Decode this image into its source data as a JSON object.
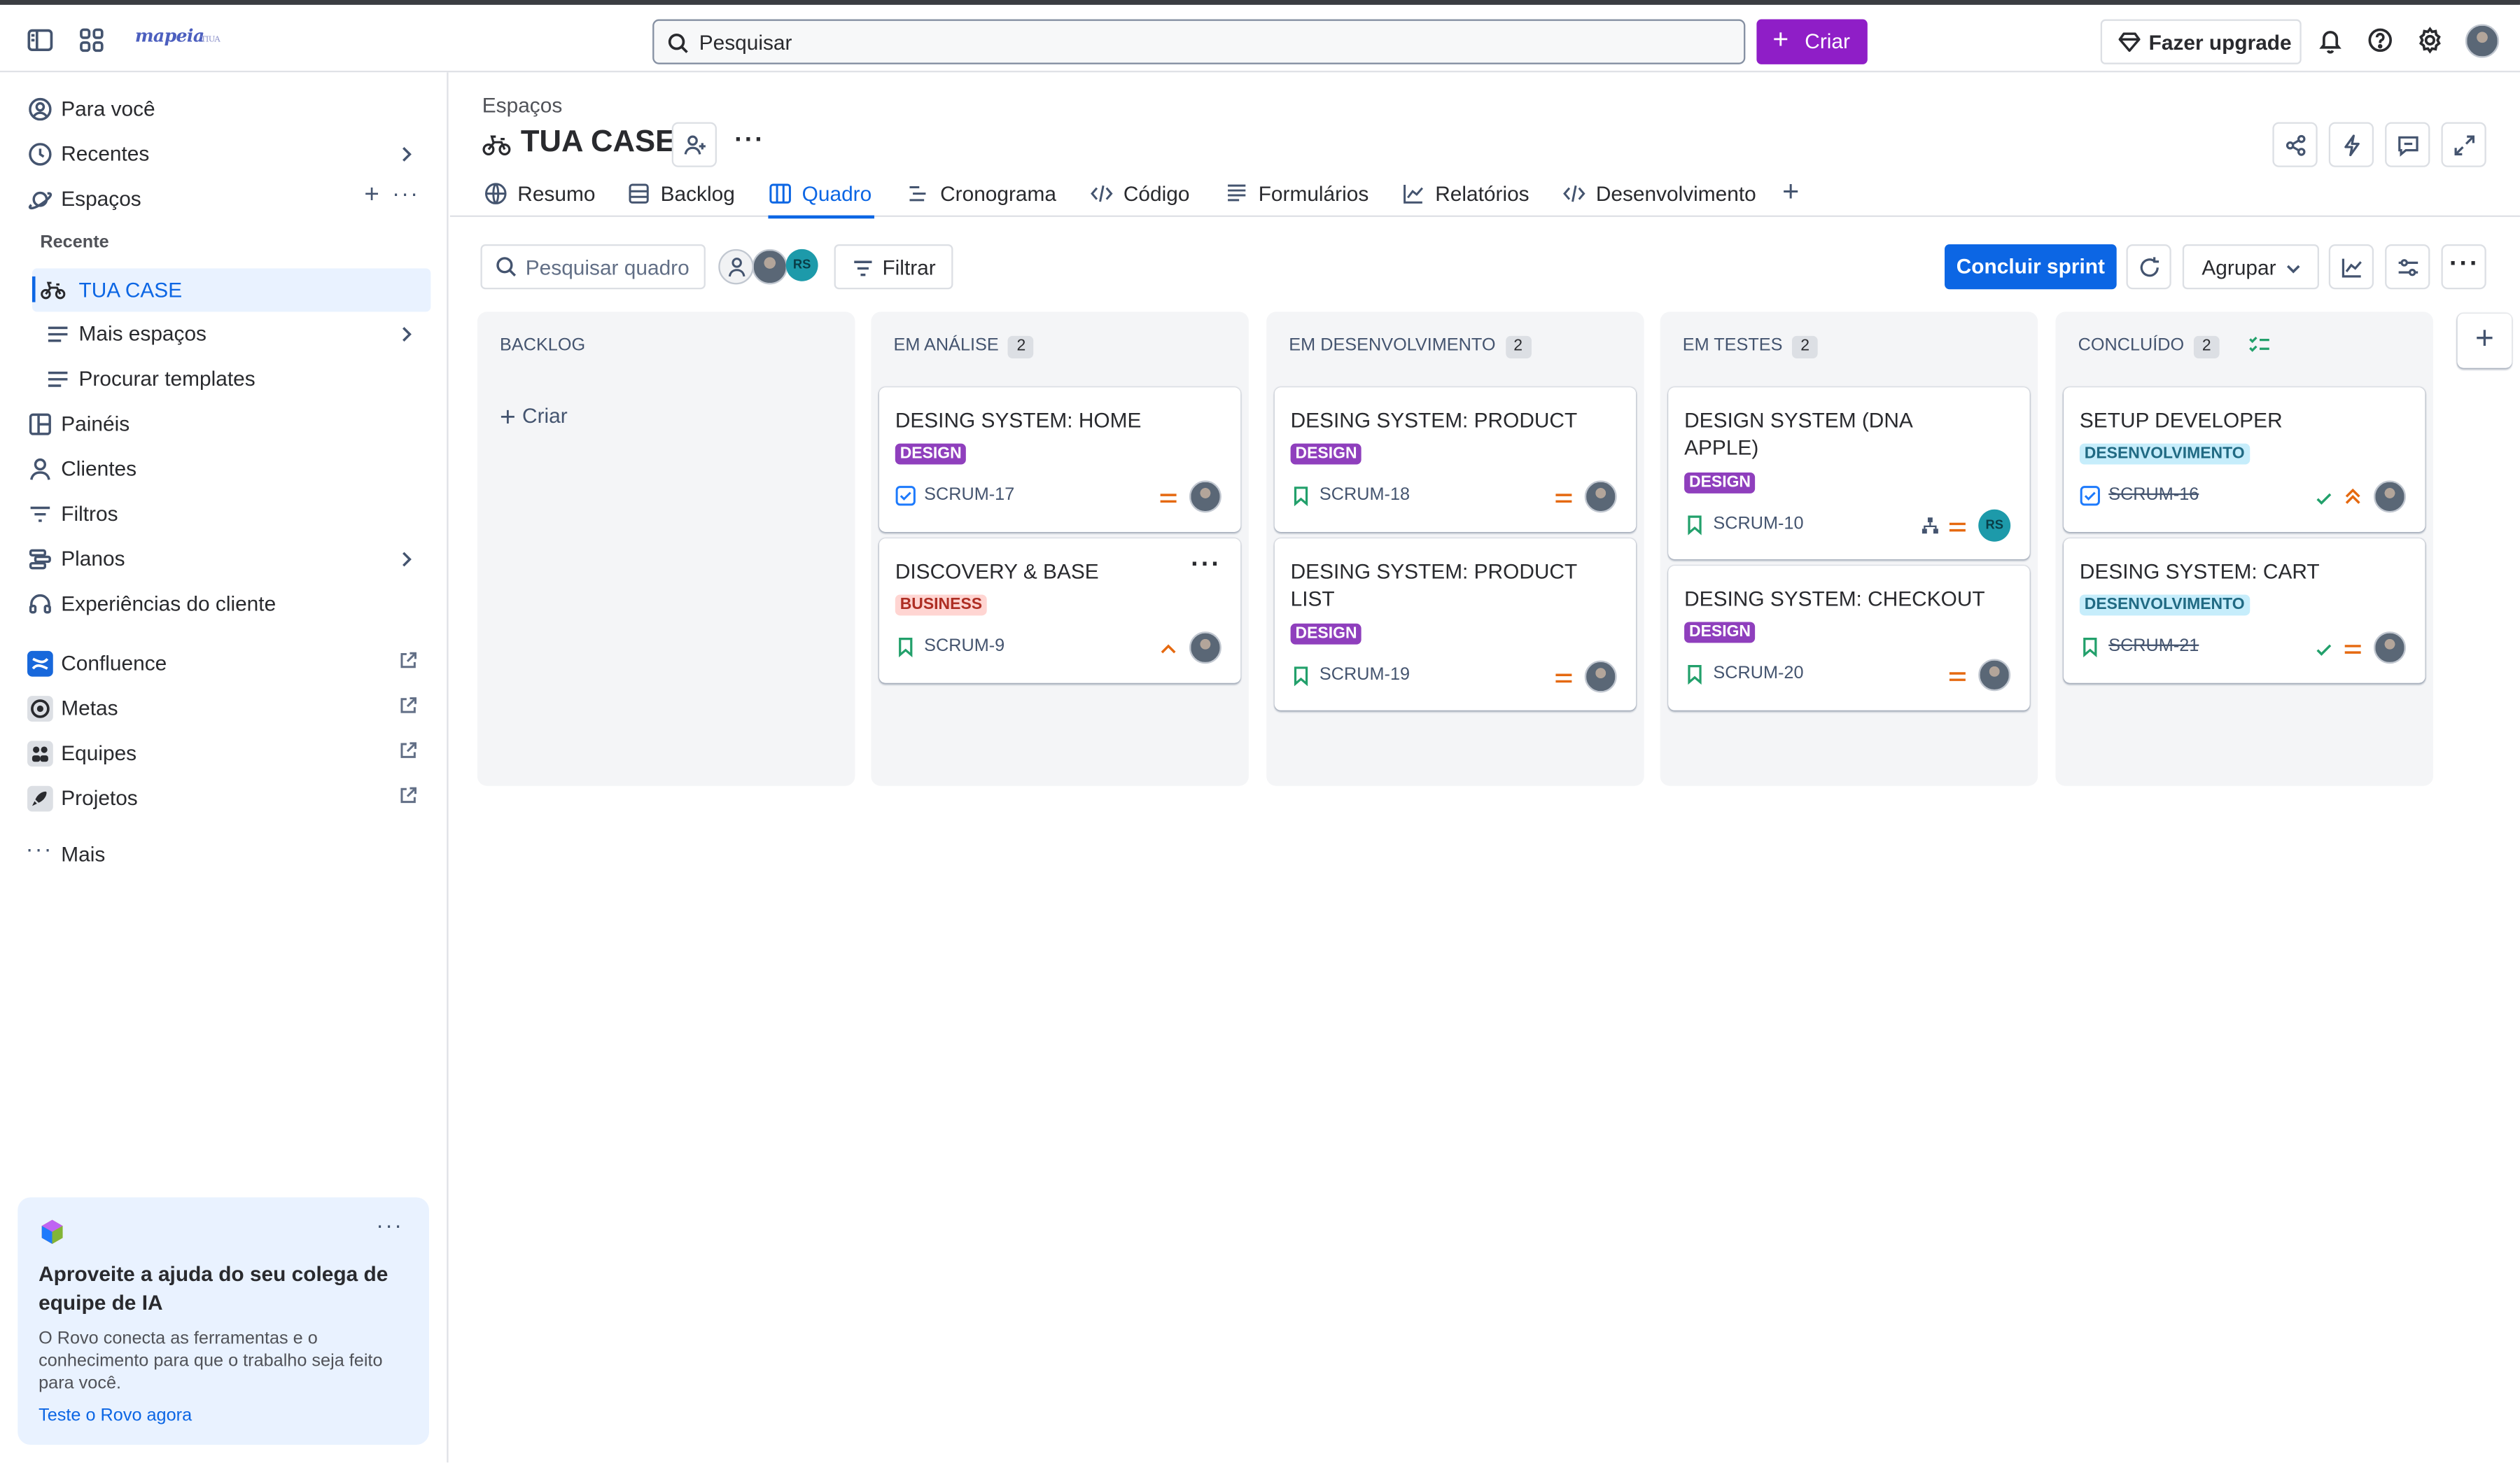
{
  "topbar": {
    "logo_text": "mapeia",
    "logo_sub": "TIUA",
    "search_placeholder": "Pesquisar",
    "create_label": "Criar",
    "upgrade_label": "Fazer upgrade",
    "create_color": "#8f1ec7"
  },
  "sidebar": {
    "items": [
      {
        "label": "Para você",
        "icon": "user-circle-icon"
      },
      {
        "label": "Recentes",
        "icon": "clock-icon"
      },
      {
        "label": "Espaços",
        "icon": "planet-icon"
      }
    ],
    "recent_heading": "Recente",
    "selected_space": "TUA CASE",
    "sub_items": [
      {
        "label": "Mais espaços",
        "icon": "lines-icon"
      },
      {
        "label": "Procurar templates",
        "icon": "lines-icon"
      }
    ],
    "items2": [
      {
        "label": "Painéis",
        "icon": "dashboard-icon"
      },
      {
        "label": "Clientes",
        "icon": "person-icon"
      },
      {
        "label": "Filtros",
        "icon": "filter-icon"
      },
      {
        "label": "Planos",
        "icon": "plans-icon"
      },
      {
        "label": "Experiências do cliente",
        "icon": "headset-icon"
      }
    ],
    "apps": [
      {
        "label": "Confluence",
        "icon": "confluence-icon"
      },
      {
        "label": "Metas",
        "icon": "goals-icon"
      },
      {
        "label": "Equipes",
        "icon": "teams-icon"
      },
      {
        "label": "Projetos",
        "icon": "projects-icon"
      }
    ],
    "more_label": "Mais",
    "rovo": {
      "title": "Aproveite a ajuda do seu colega de equipe de IA",
      "description": "O Rovo conecta as ferramentas e o conhecimento para que o trabalho seja feito para você.",
      "link": "Teste o Rovo agora"
    }
  },
  "header": {
    "breadcrumb": "Espaços",
    "title": "TUA CASE"
  },
  "tabs": [
    {
      "label": "Resumo",
      "icon": "globe-icon"
    },
    {
      "label": "Backlog",
      "icon": "backlog-icon"
    },
    {
      "label": "Quadro",
      "icon": "board-icon",
      "active": true
    },
    {
      "label": "Cronograma",
      "icon": "timeline-icon"
    },
    {
      "label": "Código",
      "icon": "code-icon"
    },
    {
      "label": "Formulários",
      "icon": "forms-icon"
    },
    {
      "label": "Relatórios",
      "icon": "reports-icon"
    },
    {
      "label": "Desenvolvimento",
      "icon": "code-icon"
    }
  ],
  "toolbar": {
    "search_placeholder": "Pesquisar quadro",
    "filter_label": "Filtrar",
    "complete_sprint_label": "Concluir sprint",
    "group_label": "Agrupar",
    "avatar_initials": "RS"
  },
  "columns": [
    {
      "title": "BACKLOG",
      "count": "",
      "add_label": "Criar",
      "cards": []
    },
    {
      "title": "EM ANÁLISE",
      "count": "2",
      "cards": [
        {
          "title": "DESING SYSTEM: HOME",
          "tag": "DESIGN",
          "key": "SCRUM-17",
          "type": "task",
          "priority": "medium"
        },
        {
          "title": "DISCOVERY & BASE",
          "tag": "BUSINESS",
          "key": "SCRUM-9",
          "type": "story",
          "priority": "low-up"
        }
      ]
    },
    {
      "title": "EM DESENVOLVIMENTO",
      "count": "2",
      "cards": [
        {
          "title": "DESING SYSTEM: PRODUCT",
          "tag": "DESIGN",
          "key": "SCRUM-18",
          "type": "story",
          "priority": "medium"
        },
        {
          "title": "DESING SYSTEM: PRODUCT LIST",
          "tag": "DESIGN",
          "key": "SCRUM-19",
          "type": "story",
          "priority": "medium"
        }
      ]
    },
    {
      "title": "EM TESTES",
      "count": "2",
      "cards": [
        {
          "title": "DESIGN SYSTEM (DNA APPLE)",
          "tag": "DESIGN",
          "key": "SCRUM-10",
          "type": "story",
          "priority": "medium"
        },
        {
          "title": "DESING SYSTEM: CHECKOUT",
          "tag": "DESIGN",
          "key": "SCRUM-20",
          "type": "story",
          "priority": "medium"
        }
      ]
    },
    {
      "title": "CONCLUÍDO",
      "count": "2",
      "cards": [
        {
          "title": "SETUP DEVELOPER",
          "tag": "DESENVOLVIMENTO",
          "key": "SCRUM-16",
          "type": "task",
          "priority": "high"
        },
        {
          "title": "DESING SYSTEM: CART",
          "tag": "DESENVOLVIMENTO",
          "key": "SCRUM-21",
          "type": "story",
          "priority": "medium"
        }
      ]
    }
  ]
}
